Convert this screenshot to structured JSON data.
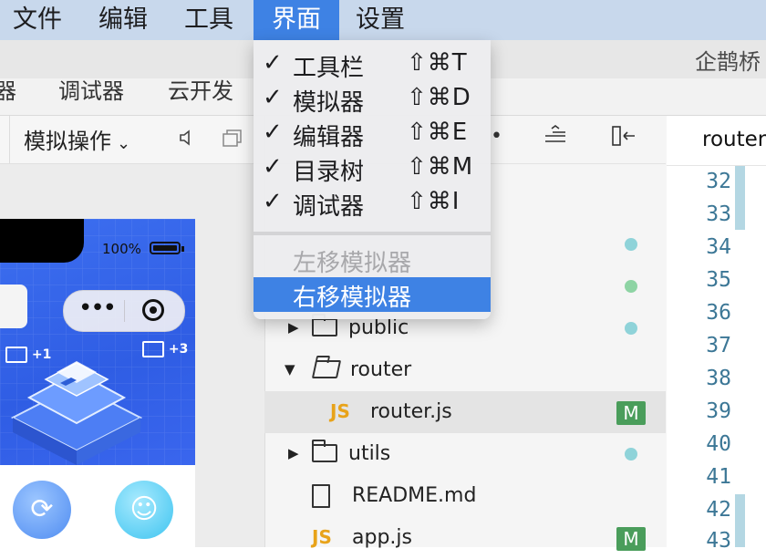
{
  "menubar": {
    "items": [
      "文件",
      "编辑",
      "工具",
      "界面",
      "设置"
    ],
    "active_index": 3
  },
  "window": {
    "title": "企鹊桥"
  },
  "tabbar": {
    "tabs": [
      "器",
      "调试器",
      "云开发"
    ]
  },
  "sim_toolbar": {
    "ops_label": "模拟操作",
    "chevron": "⌄"
  },
  "simulator": {
    "battery": "100%",
    "capsule_dots": "•••",
    "badges": [
      "+1",
      "+3"
    ]
  },
  "tree": {
    "rows": [
      {
        "name": "",
        "kind": "folder",
        "status": "dot-teal"
      },
      {
        "name": "",
        "kind": "folder",
        "status": "dot-green"
      },
      {
        "name": "public",
        "kind": "folder",
        "expanded": false,
        "status": "dot-teal"
      },
      {
        "name": "router",
        "kind": "folder",
        "expanded": true,
        "status": ""
      },
      {
        "name": "router.js",
        "kind": "js",
        "selected": true,
        "status": "M"
      },
      {
        "name": "utils",
        "kind": "folder",
        "expanded": false,
        "status": "dot-teal"
      },
      {
        "name": "README.md",
        "kind": "file",
        "status": ""
      },
      {
        "name": "app.js",
        "kind": "js",
        "status": "M"
      }
    ],
    "js_icon": "JS",
    "m_badge": "M"
  },
  "editor": {
    "tab_label": "router.",
    "line_numbers": [
      "32",
      "33",
      "34",
      "35",
      "36",
      "37",
      "38",
      "39",
      "40",
      "41",
      "42",
      "43"
    ]
  },
  "dropdown": {
    "items": [
      {
        "check": "✓",
        "label": "工具栏",
        "shortcut": "⇧⌘T"
      },
      {
        "check": "✓",
        "label": "模拟器",
        "shortcut": "⇧⌘D"
      },
      {
        "check": "✓",
        "label": "编辑器",
        "shortcut": "⇧⌘E"
      },
      {
        "check": "✓",
        "label": "目录树",
        "shortcut": "⇧⌘M"
      },
      {
        "check": "✓",
        "label": "调试器",
        "shortcut": "⇧⌘I"
      }
    ],
    "disabled_item": "左移模拟器",
    "highlighted_item": "右移模拟器"
  },
  "colors": {
    "menubar_bg": "#c8d8ec",
    "accent": "#3e82e4",
    "modified_badge": "#4a9d5b",
    "dot_teal": "#8fd3d9",
    "dot_green": "#8ed4a4",
    "js_icon": "#e8a31a",
    "line_number": "#3c7796"
  }
}
